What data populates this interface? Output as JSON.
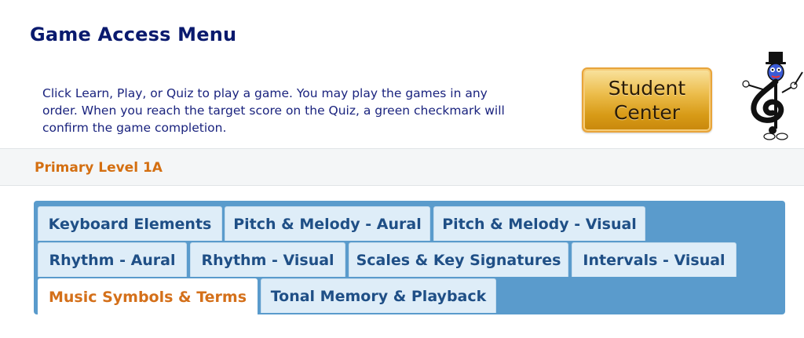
{
  "header": {
    "title": "Game Access Menu",
    "instructions": "Click Learn, Play, or Quiz to play a game. You may play the games in any order. When you reach the target score on the Quiz, a green checkmark will confirm the game completion."
  },
  "student_center": {
    "line1": "Student",
    "line2": "Center"
  },
  "mascot": {
    "icon": "treble-clef-mascot-icon"
  },
  "level": {
    "title": "Primary Level 1A"
  },
  "tabs": [
    {
      "label": "Keyboard Elements",
      "active": false
    },
    {
      "label": "Pitch & Melody - Aural",
      "active": false
    },
    {
      "label": "Pitch & Melody - Visual",
      "active": false
    },
    {
      "label": "Rhythm - Aural",
      "active": false
    },
    {
      "label": "Rhythm - Visual",
      "active": false
    },
    {
      "label": "Scales & Key Signatures",
      "active": false
    },
    {
      "label": "Intervals - Visual",
      "active": false
    },
    {
      "label": "Music Symbols & Terms",
      "active": true
    },
    {
      "label": "Tonal Memory & Playback",
      "active": false
    }
  ],
  "colors": {
    "title": "#0a1a6e",
    "instructions": "#1a237e",
    "level_title": "#d46f11",
    "tab_panel": "#5a9bcc",
    "tab_bg": "#deedf8",
    "tab_text": "#1f4f86",
    "active_tab_text": "#d4701a"
  }
}
